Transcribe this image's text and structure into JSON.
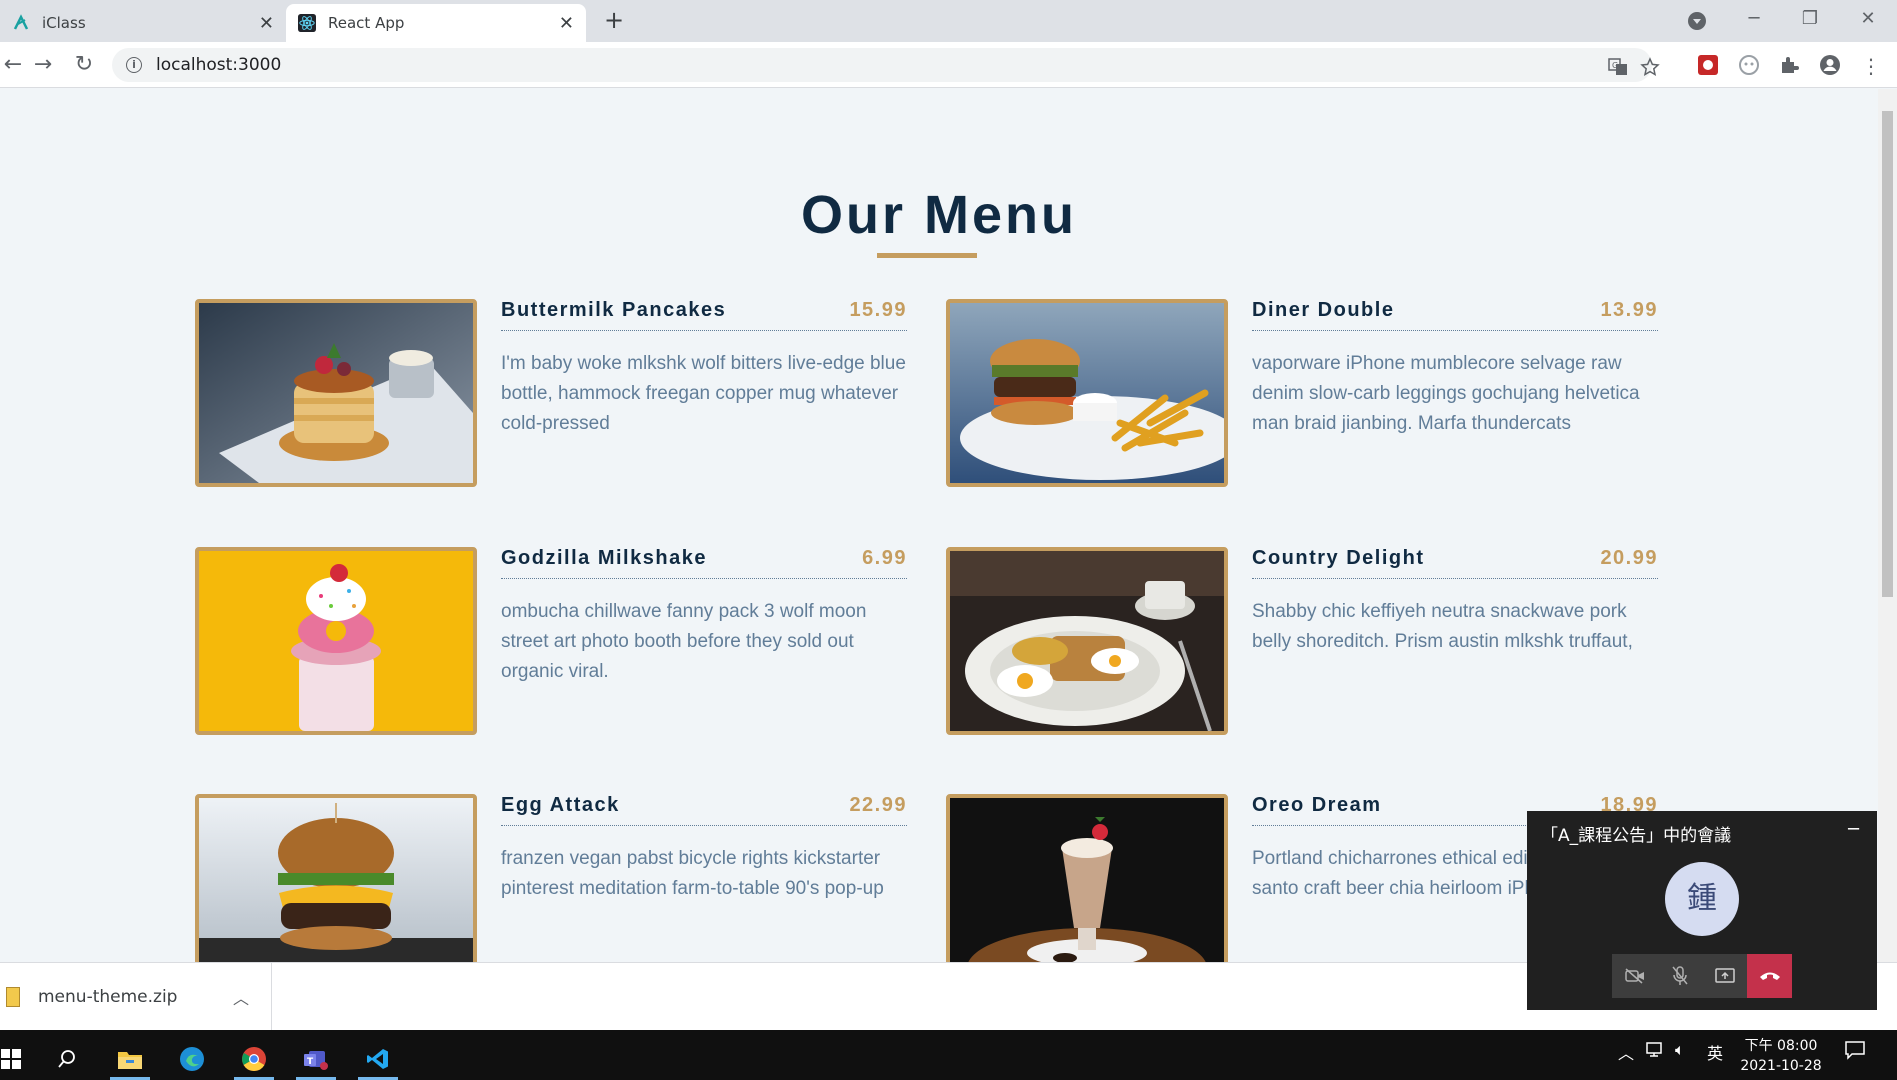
{
  "browser": {
    "tabs": [
      {
        "label": "iClass",
        "icon": "iclass-icon",
        "active": false
      },
      {
        "label": "React App",
        "icon": "react-icon",
        "active": true
      }
    ],
    "url": "localhost:3000"
  },
  "page": {
    "title": "Our Menu",
    "items": [
      {
        "name": "Buttermilk Pancakes",
        "price": "15.99",
        "desc": "I'm baby woke mlkshk wolf bitters live-edge blue bottle, hammock freegan copper mug whatever cold-pressed",
        "image": "pancakes-photo"
      },
      {
        "name": "Diner Double",
        "price": "13.99",
        "desc": "vaporware iPhone mumblecore selvage raw denim slow-carb leggings gochujang helvetica man braid jianbing. Marfa thundercats",
        "image": "burger-fries-photo"
      },
      {
        "name": "Godzilla Milkshake",
        "price": "6.99",
        "desc": "ombucha chillwave fanny pack 3 wolf moon street art photo booth before they sold out organic viral.",
        "image": "milkshake-photo"
      },
      {
        "name": "Country Delight",
        "price": "20.99",
        "desc": "Shabby chic keffiyeh neutra snackwave pork belly shoreditch. Prism austin mlkshk truffaut,",
        "image": "breakfast-plate-photo"
      },
      {
        "name": "Egg Attack",
        "price": "22.99",
        "desc": "franzen vegan pabst bicycle rights kickstarter pinterest meditation farm-to-table 90's pop-up",
        "image": "egg-burger-photo"
      },
      {
        "name": "Oreo Dream",
        "price": "18.99",
        "desc": "Portland chicharrones ethical edison bulb, palo santo craft beer chia heirloom iPhone everyday",
        "image": "oreo-shake-photo"
      }
    ]
  },
  "download": {
    "filename": "menu-theme.zip"
  },
  "meeting": {
    "title": "「A_課程公告」中的會議",
    "avatar_text": "鍾"
  },
  "taskbar": {
    "ime": "英",
    "time": "下午 08:00",
    "date": "2021-10-28"
  },
  "colors": {
    "accent": "#c59d5f",
    "heading": "#102a42",
    "text": "#617d98",
    "background": "#f1f5f8",
    "hangup": "#c4314b"
  }
}
